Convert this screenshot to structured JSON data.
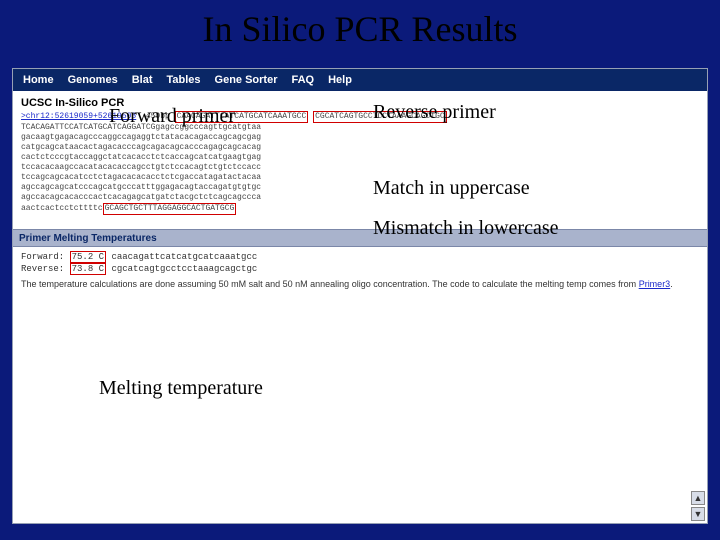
{
  "title": "In Silico PCR Results",
  "nav": {
    "items": [
      "Home",
      "Genomes",
      "Blat",
      "Tables",
      "Gene Sorter",
      "FAQ",
      "Help"
    ]
  },
  "tool_title": "UCSC In-Silico PCR",
  "seq": {
    "header_link": ">chr12:52619059+52619508",
    "header_len": "450bp",
    "fwd_box": "CAACAGATTCATCATGCATCAAATGCC",
    "rev_box": "CGCATCAGTGCCTCCTAAAGCAGCTGC",
    "lines": [
      "TCACAGATTCCATCATGCATCAGGATCGgagccggcccagttgcatgtaa",
      "gacaagtgagacagcccaggccagaggtctatacacagaccagcagcgag",
      "catgcagcataacactagacacccagcagacagcacccagagcagcacag",
      "cactctcccgtaccaggctatcacacctctcaccagcatcatgaagtgag",
      "tccacacaagccacatacacaccagcctgtctccacagtctgtctccacc",
      "tccagcagcacatcctctagacacacacctctcgaccatagatactacaa",
      "agccagcagcatcccagcatgcccatttggagacagtaccagatgtgtgc",
      "agccacagcacacccactcacagagcatgatctacgctctcagcagccca"
    ],
    "bottom_left": "aactcactcctcttttc",
    "bottom_box": "GCAGCTGCTTTAGGAGGCACTGATGCG"
  },
  "labels": {
    "forward": "Forward primer",
    "reverse": "Reverse primer",
    "match": "Match in uppercase",
    "mismatch": "Mismatch in lowercase",
    "melting": "Melting temperature"
  },
  "section_bar": "Primer Melting Temperatures",
  "melting": {
    "fwd_label": "Forward:",
    "fwd_temp": "75.2 C",
    "fwd_seq": "caacagattcatcatgcatcaaatgcc",
    "rev_label": "Reverse:",
    "rev_temp": "73.8 C",
    "rev_seq": "cgcatcagtgcctcctaaagcagctgc",
    "note_prefix": "The temperature calculations are done assuming 50 mM salt and 50 nM annealing oligo concentration. The code to calculate the melting temp comes from ",
    "note_link": "Primer3"
  }
}
